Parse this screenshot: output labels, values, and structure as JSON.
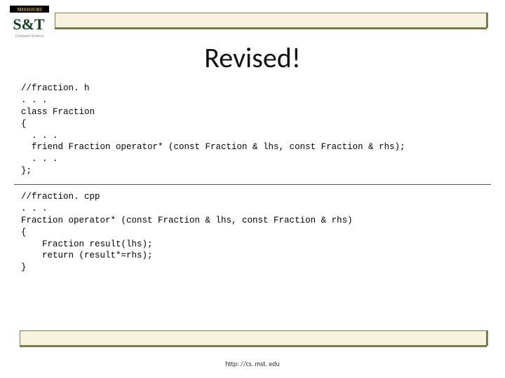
{
  "logo": {
    "top_text": "MISSOURI",
    "big": "S&T",
    "sub": "Computer Science"
  },
  "title": "Revised!",
  "code_header": "//fraction. h\n. . .\nclass Fraction\n{\n  . . .\n  friend Fraction operator* (const Fraction & lhs, const Fraction & rhs);\n  . . .\n};",
  "code_impl": "//fraction. cpp\n. . .\nFraction operator* (const Fraction & lhs, const Fraction & rhs)\n{\n    Fraction result(lhs);\n    return (result*=rhs);\n}",
  "footer": "http: //cs. mst. edu"
}
